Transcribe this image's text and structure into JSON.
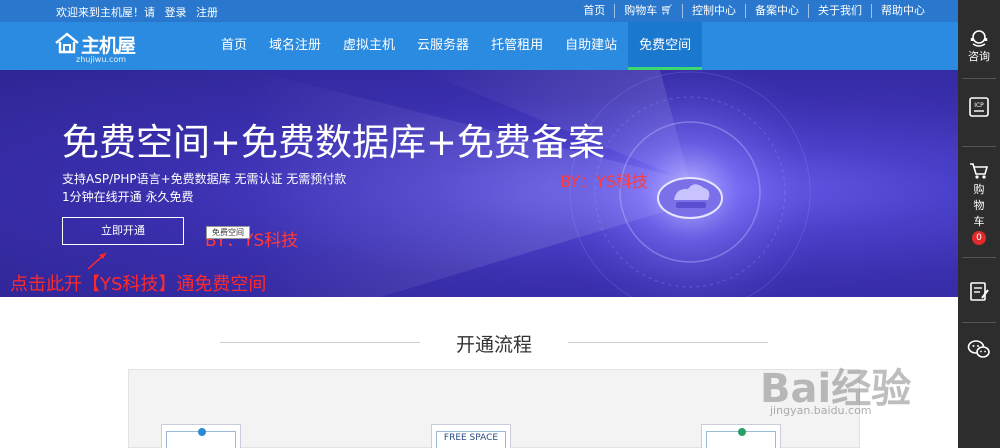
{
  "topbar": {
    "welcome": "欢迎来到主机屋！请",
    "login": "登录",
    "register": "注册",
    "links": [
      "首页",
      "购物车",
      "控制中心",
      "备案中心",
      "关于我们",
      "帮助中心"
    ]
  },
  "logo": {
    "name": "主机屋",
    "sub": "zhujiwu.com"
  },
  "nav": {
    "items": [
      "首页",
      "域名注册",
      "虚拟主机",
      "云服务器",
      "托管租用",
      "自助建站",
      "免费空间"
    ],
    "active_index": 6
  },
  "banner": {
    "headline": "免费空间+免费数据库+免费备案",
    "sub1": "支持ASP/PHP语言+免费数据库 无需认证 无需预付款",
    "sub2": "1分钟在线开通 永久免费",
    "button": "立即开通",
    "watermark_mid": "BY：YS科技",
    "watermark_btn": "BY：YS科技",
    "mini_tag": "免费空间",
    "caption": "点击此开【YS科技】通免费空间"
  },
  "process": {
    "title": "开通流程",
    "card_center_label": "FREE SPACE"
  },
  "watermark": {
    "main": "Bai经验",
    "sub": "jingyan.baidu.com"
  },
  "sidebar": {
    "consult": "咨询",
    "icp": "ICP",
    "cart_chars": [
      "购",
      "物",
      "车"
    ],
    "cart_count": "0"
  },
  "colors": {
    "topbar": "#2a78cd",
    "nav": "#2a8be0",
    "active_underline": "#3dd86f",
    "banner": "#3a2fad",
    "sidebar": "#2d2d2d",
    "watermark_red": "#ff3b3b"
  }
}
